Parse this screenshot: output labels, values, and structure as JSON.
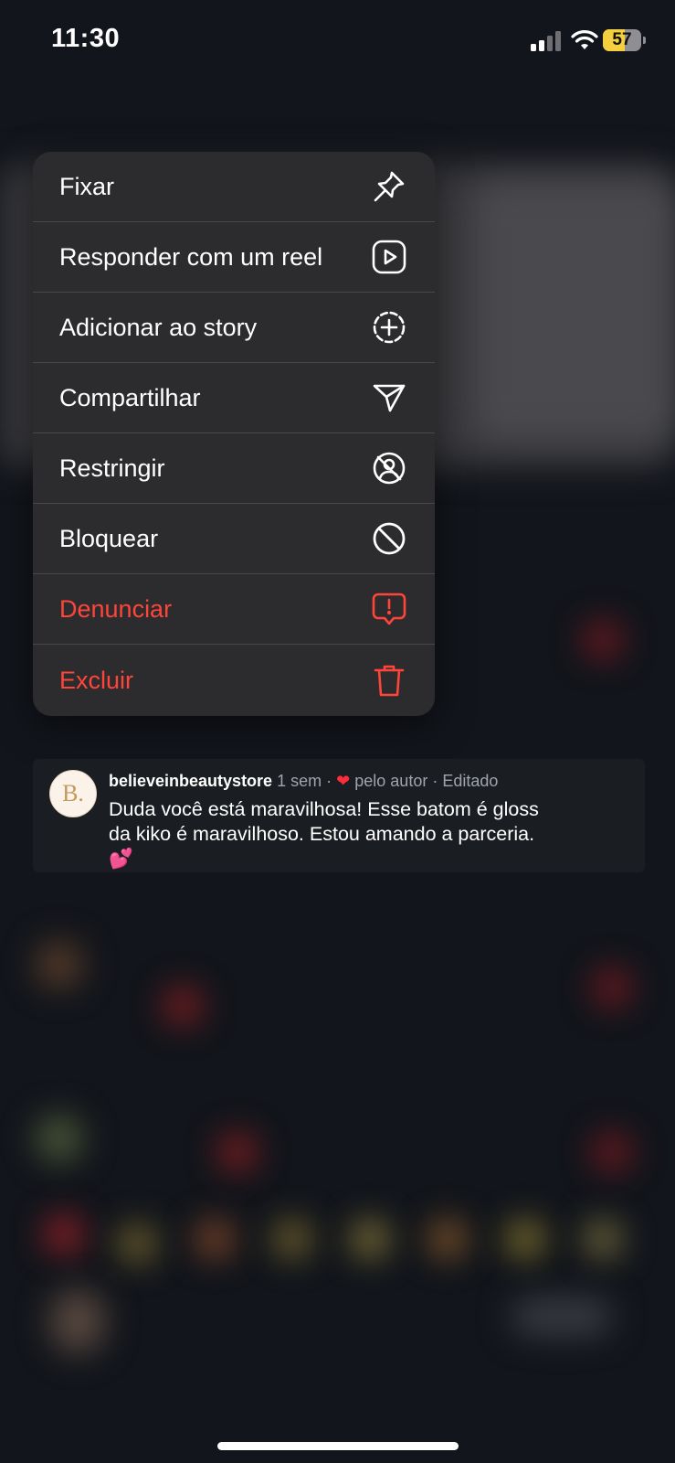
{
  "status_bar": {
    "time": "11:30",
    "battery_level": "57",
    "battery_color": "#f4d03f"
  },
  "menu": {
    "items": [
      {
        "label": "Fixar",
        "icon": "pin-icon",
        "danger": false
      },
      {
        "label": "Responder com um reel",
        "icon": "reel-icon",
        "danger": false
      },
      {
        "label": "Adicionar ao story",
        "icon": "add-story-icon",
        "danger": false
      },
      {
        "label": "Compartilhar",
        "icon": "send-icon",
        "danger": false
      },
      {
        "label": "Restringir",
        "icon": "restrict-icon",
        "danger": false
      },
      {
        "label": "Bloquear",
        "icon": "block-icon",
        "danger": false
      },
      {
        "label": "Denunciar",
        "icon": "report-icon",
        "danger": true
      },
      {
        "label": "Excluir",
        "icon": "trash-icon",
        "danger": true
      }
    ],
    "danger_color": "#ff453a"
  },
  "comment": {
    "avatar_letter": "B.",
    "username": "believeinbeautystore",
    "age": "1 sem",
    "separator": "·",
    "liked_by": "pelo autor",
    "edited": "Editado",
    "text": "Duda você está maravilhosa! Esse batom é gloss da kiko é maravilhoso. Estou amando a parceria. 💕"
  }
}
